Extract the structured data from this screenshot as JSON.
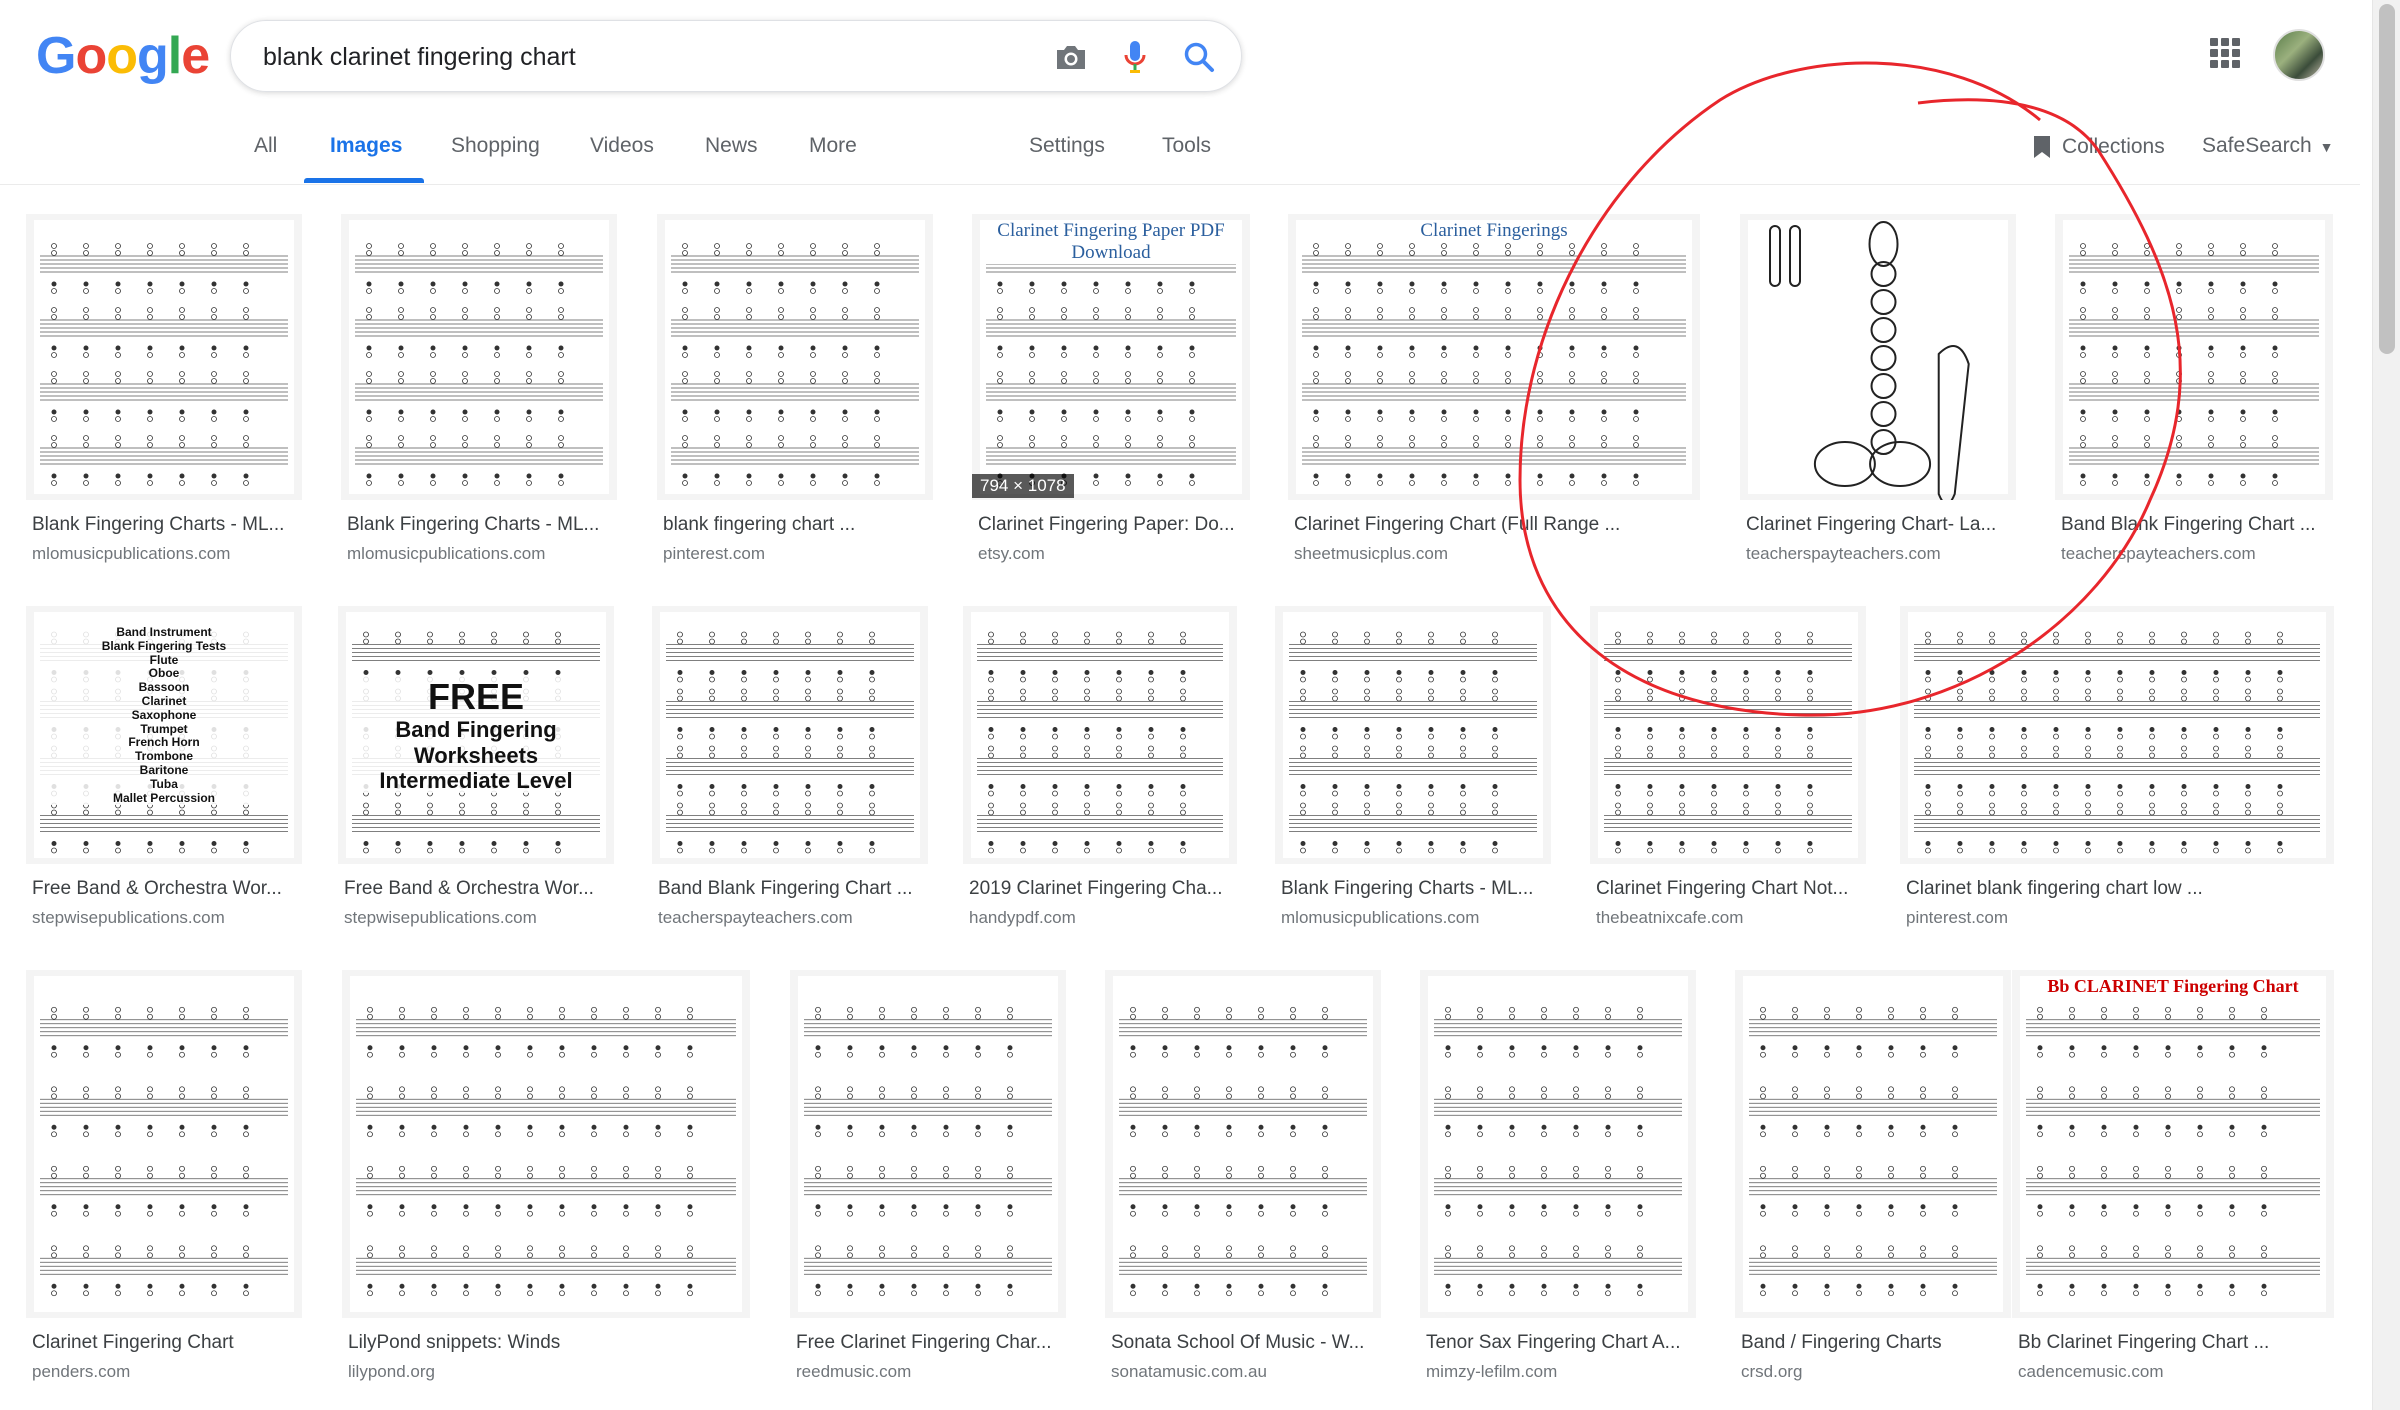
{
  "logo": [
    "G",
    "o",
    "o",
    "g",
    "l",
    "e"
  ],
  "logo_colors": [
    "#4285f4",
    "#ea4335",
    "#fbbc05",
    "#4285f4",
    "#34a853",
    "#ea4335"
  ],
  "search": {
    "query": "blank clarinet fingering chart"
  },
  "tabs": [
    "All",
    "Images",
    "Shopping",
    "Videos",
    "News",
    "More",
    "Settings",
    "Tools"
  ],
  "toolbar": {
    "collections": "Collections",
    "safesearch": "SafeSearch"
  },
  "results": [
    {
      "title": "Blank Fingering Charts - ML...",
      "domain": "mlomusicpublications.com"
    },
    {
      "title": "Blank Fingering Charts - ML...",
      "domain": "mlomusicpublications.com"
    },
    {
      "title": "blank fingering chart ...",
      "domain": "pinterest.com"
    },
    {
      "title": "Clarinet Fingering Paper: Do...",
      "domain": "etsy.com",
      "dims": "794 × 1078",
      "thumb_title": "Clarinet Fingering Paper PDF Download"
    },
    {
      "title": "Clarinet Fingering Chart (Full Range ...",
      "domain": "sheetmusicplus.com",
      "thumb_title": "Clarinet Fingerings"
    },
    {
      "title": "Clarinet Fingering Chart- La...",
      "domain": "teacherspayteachers.com"
    },
    {
      "title": "Band Blank Fingering Chart ...",
      "domain": "teacherspayteachers.com"
    },
    {
      "title": "Free Band & Orchestra Wor...",
      "domain": "stepwisepublications.com",
      "thumb_lines": [
        "Band Instrument",
        "Blank Fingering Tests",
        "Flute",
        "Oboe",
        "Bassoon",
        "Clarinet",
        "Saxophone",
        "Trumpet",
        "French Horn",
        "Trombone",
        "Baritone",
        "Tuba",
        "Mallet Percussion"
      ]
    },
    {
      "title": "Free Band & Orchestra Wor...",
      "domain": "stepwisepublications.com",
      "thumb_lines": [
        "FREE",
        "Band Fingering",
        "Worksheets",
        "Intermediate Level"
      ]
    },
    {
      "title": "Band Blank Fingering Chart ...",
      "domain": "teacherspayteachers.com"
    },
    {
      "title": "2019 Clarinet Fingering Cha...",
      "domain": "handypdf.com"
    },
    {
      "title": "Blank Fingering Charts - ML...",
      "domain": "mlomusicpublications.com"
    },
    {
      "title": "Clarinet Fingering Chart Not...",
      "domain": "thebeatnixcafe.com"
    },
    {
      "title": "Clarinet blank fingering chart low ...",
      "domain": "pinterest.com"
    },
    {
      "title": "Clarinet Fingering Chart",
      "domain": "penders.com"
    },
    {
      "title": "LilyPond snippets: Winds",
      "domain": "lilypond.org"
    },
    {
      "title": "Free Clarinet Fingering Char...",
      "domain": "reedmusic.com"
    },
    {
      "title": "Sonata School Of Music - W...",
      "domain": "sonatamusic.com.au"
    },
    {
      "title": "Tenor Sax Fingering Chart A...",
      "domain": "mimzy-lefilm.com"
    },
    {
      "title": "Band / Fingering Charts",
      "domain": "crsd.org"
    },
    {
      "title": "Bb Clarinet Fingering Chart ...",
      "domain": "cadencemusic.com",
      "thumb_title": "Bb CLARINET Fingering Chart"
    }
  ],
  "annotation_color": "#e8262c"
}
